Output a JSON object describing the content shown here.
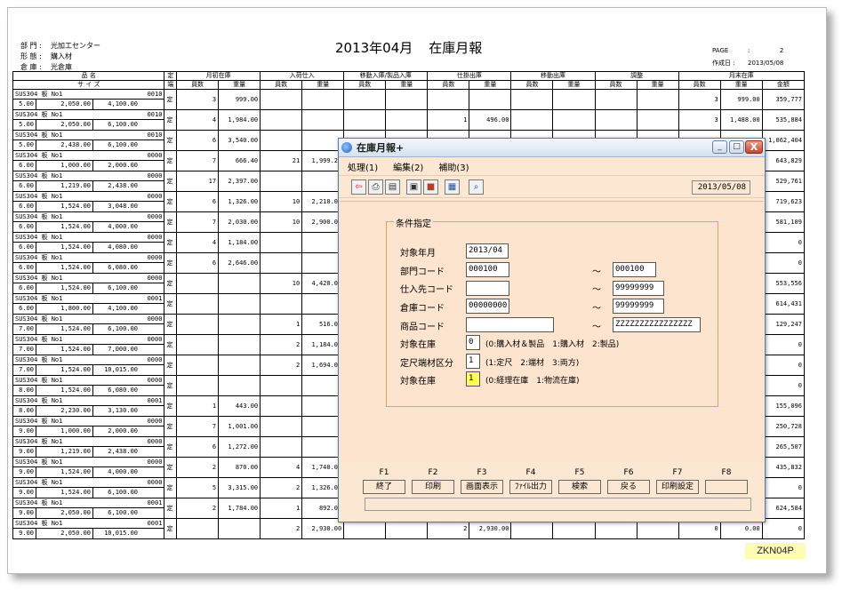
{
  "report": {
    "dept_label": "部 門 :",
    "dept_value": "光加工センター",
    "form_label": "形 態 :",
    "form_value": "購入材",
    "warehouse_label": "倉 庫 :",
    "warehouse_value": "光倉庫",
    "title_period": "2013年04月",
    "title_name": "在庫月報",
    "page_label": "PAGE",
    "page_sep": ":",
    "page_value": "2",
    "created_label": "作成日 :",
    "created_value": "2013/05/08",
    "head": {
      "name": "品 名",
      "size": "サ イ ズ",
      "tei": "定",
      "tan": "端",
      "opening": "月初在庫",
      "purchase": "入荷仕入",
      "transfer_in": "移動入庫/製品入庫",
      "issue": "仕掛出庫",
      "transfer_out": "移動出庫",
      "adjust": "調整",
      "closing": "月末在庫",
      "qty": "員数",
      "weight": "重量",
      "amount": "金額"
    },
    "rows": [
      {
        "name": "SUS304 板 No1",
        "code": "0010",
        "t": "5.00",
        "w": "2,050.00",
        "l": "4,100.00",
        "tei": "定",
        "o_q": "3",
        "o_w": "999.00",
        "p_q": "",
        "p_w": "",
        "i_q": "",
        "i_w": "",
        "c_q": "3",
        "c_w": "999.00",
        "amt": "359,777"
      },
      {
        "name": "SUS304 板 No1",
        "code": "0010",
        "t": "5.00",
        "w": "2,050.00",
        "l": "6,100.00",
        "tei": "定",
        "o_q": "4",
        "o_w": "1,984.00",
        "p_q": "",
        "p_w": "",
        "i_q": "1",
        "i_w": "496.00",
        "c_q": "3",
        "c_w": "1,488.00",
        "amt": "535,884"
      },
      {
        "name": "SUS304 板 No1",
        "code": "0010",
        "t": "5.00",
        "w": "2,438.00",
        "l": "6,100.00",
        "tei": "定",
        "o_q": "6",
        "o_w": "3,540.00",
        "p_q": "",
        "p_w": "",
        "i_q": "",
        "i_w": "",
        "c_q": "",
        "c_w": "",
        "amt": "1,062,404"
      },
      {
        "name": "SUS304 板 No1",
        "code": "0000",
        "t": "6.00",
        "w": "1,000.00",
        "l": "2,000.00",
        "tei": "定",
        "o_q": "7",
        "o_w": "666.40",
        "p_q": "21",
        "p_w": "1,999.20",
        "i_q": "",
        "i_w": "",
        "c_q": "",
        "c_w": "",
        "amt": "643,829"
      },
      {
        "name": "SUS304 板 No1",
        "code": "0000",
        "t": "6.00",
        "w": "1,219.00",
        "l": "2,438.00",
        "tei": "定",
        "o_q": "17",
        "o_w": "2,397.00",
        "p_q": "",
        "p_w": "",
        "i_q": "",
        "i_w": "",
        "c_q": "",
        "c_w": "",
        "amt": "529,761"
      },
      {
        "name": "SUS304 板 No1",
        "code": "0000",
        "t": "6.00",
        "w": "1,524.00",
        "l": "3,048.00",
        "tei": "定",
        "o_q": "6",
        "o_w": "1,326.00",
        "p_q": "10",
        "p_w": "2,210.00",
        "i_q": "",
        "i_w": "",
        "c_q": "",
        "c_w": "",
        "amt": "719,623"
      },
      {
        "name": "SUS304 板 No1",
        "code": "0000",
        "t": "6.00",
        "w": "1,524.00",
        "l": "4,000.00",
        "tei": "定",
        "o_q": "7",
        "o_w": "2,030.00",
        "p_q": "10",
        "p_w": "2,900.00",
        "i_q": "",
        "i_w": "",
        "c_q": "",
        "c_w": "",
        "amt": "581,109"
      },
      {
        "name": "SUS304 板 No1",
        "code": "0000",
        "t": "6.00",
        "w": "1,524.00",
        "l": "4,080.00",
        "tei": "定",
        "o_q": "4",
        "o_w": "1,184.00",
        "p_q": "",
        "p_w": "",
        "i_q": "",
        "i_w": "",
        "c_q": "",
        "c_w": "",
        "amt": "0"
      },
      {
        "name": "SUS304 板 No1",
        "code": "0000",
        "t": "6.00",
        "w": "1,524.00",
        "l": "6,080.00",
        "tei": "定",
        "o_q": "6",
        "o_w": "2,646.00",
        "p_q": "",
        "p_w": "",
        "i_q": "",
        "i_w": "",
        "c_q": "",
        "c_w": "",
        "amt": "0"
      },
      {
        "name": "SUS304 板 No1",
        "code": "0000",
        "t": "6.00",
        "w": "1,524.00",
        "l": "6,100.00",
        "tei": "定",
        "o_q": "",
        "o_w": "",
        "p_q": "10",
        "p_w": "4,420.00",
        "i_q": "",
        "i_w": "",
        "c_q": "",
        "c_w": "",
        "amt": "553,556"
      },
      {
        "name": "SUS304 板 No1",
        "code": "0001",
        "t": "6.00",
        "w": "1,800.00",
        "l": "4,100.00",
        "tei": "定",
        "o_q": "",
        "o_w": "",
        "p_q": "",
        "p_w": "",
        "i_q": "",
        "i_w": "",
        "c_q": "",
        "c_w": "",
        "amt": "614,431"
      },
      {
        "name": "SUS304 板 No1",
        "code": "0000",
        "t": "7.00",
        "w": "1,524.00",
        "l": "6,100.00",
        "tei": "定",
        "o_q": "",
        "o_w": "",
        "p_q": "1",
        "p_w": "516.00",
        "i_q": "",
        "i_w": "",
        "c_q": "",
        "c_w": "",
        "amt": "129,247"
      },
      {
        "name": "SUS304 板 No1",
        "code": "0000",
        "t": "7.00",
        "w": "1,524.00",
        "l": "7,000.00",
        "tei": "定",
        "o_q": "",
        "o_w": "",
        "p_q": "2",
        "p_w": "1,184.00",
        "i_q": "",
        "i_w": "",
        "c_q": "",
        "c_w": "",
        "amt": "0"
      },
      {
        "name": "SUS304 板 No1",
        "code": "0000",
        "t": "7.00",
        "w": "1,524.00",
        "l": "10,015.00",
        "tei": "定",
        "o_q": "",
        "o_w": "",
        "p_q": "2",
        "p_w": "1,694.00",
        "i_q": "",
        "i_w": "",
        "c_q": "",
        "c_w": "",
        "amt": "0"
      },
      {
        "name": "SUS304 板 No1",
        "code": "0000",
        "t": "8.00",
        "w": "1,524.00",
        "l": "6,080.00",
        "tei": "定",
        "o_q": "",
        "o_w": "",
        "p_q": "",
        "p_w": "",
        "i_q": "",
        "i_w": "",
        "c_q": "",
        "c_w": "",
        "amt": "0"
      },
      {
        "name": "SUS304 板 No1",
        "code": "0001",
        "t": "8.00",
        "w": "2,230.00",
        "l": "3,130.00",
        "tei": "定",
        "o_q": "1",
        "o_w": "443.00",
        "p_q": "",
        "p_w": "",
        "i_q": "",
        "i_w": "",
        "c_q": "",
        "c_w": "",
        "amt": "155,096"
      },
      {
        "name": "SUS304 板 No1",
        "code": "0000",
        "t": "9.00",
        "w": "1,000.00",
        "l": "2,000.00",
        "tei": "定",
        "o_q": "7",
        "o_w": "1,001.00",
        "p_q": "",
        "p_w": "",
        "i_q": "",
        "i_w": "",
        "c_q": "",
        "c_w": "",
        "amt": "250,728"
      },
      {
        "name": "SUS304 板 No1",
        "code": "0000",
        "t": "9.00",
        "w": "1,219.00",
        "l": "2,438.00",
        "tei": "定",
        "o_q": "6",
        "o_w": "1,272.00",
        "p_q": "",
        "p_w": "",
        "i_q": "",
        "i_w": "",
        "c_q": "",
        "c_w": "",
        "amt": "265,507"
      },
      {
        "name": "SUS304 板 No1",
        "code": "0000",
        "t": "9.00",
        "w": "1,524.00",
        "l": "4,000.00",
        "tei": "定",
        "o_q": "2",
        "o_w": "870.00",
        "p_q": "4",
        "p_w": "1,740.00",
        "i_q": "",
        "i_w": "",
        "c_q": "",
        "c_w": "",
        "amt": "435,832"
      },
      {
        "name": "SUS304 板 No1",
        "code": "0000",
        "t": "9.00",
        "w": "1,524.00",
        "l": "6,100.00",
        "tei": "定",
        "o_q": "5",
        "o_w": "3,315.00",
        "p_q": "2",
        "p_w": "1,326.00",
        "i_q": "",
        "i_w": "",
        "c_q": "",
        "c_w": "",
        "amt": "0"
      },
      {
        "name": "SUS304 板 No1",
        "code": "0001",
        "t": "9.00",
        "w": "2,050.00",
        "l": "6,100.00",
        "tei": "定",
        "o_q": "2",
        "o_w": "1,784.00",
        "p_q": "1",
        "p_w": "892.00",
        "i_q": "",
        "i_w": "",
        "c_q": "",
        "c_w": "",
        "amt": "624,584"
      },
      {
        "name": "SUS304 板 No1",
        "code": "0001",
        "t": "9.00",
        "w": "2,050.00",
        "l": "10,015.00",
        "tei": "定",
        "o_q": "",
        "o_w": "",
        "p_q": "2",
        "p_w": "2,930.00",
        "i_q": "2",
        "i_w": "2,930.00",
        "c_q": "0",
        "c_w": "0.00",
        "amt": "0"
      }
    ]
  },
  "stamp": "ZKN04P",
  "window": {
    "title": "在庫月報+",
    "min": "_",
    "max": "□",
    "close": "X",
    "menu": [
      "処理(1)",
      "編集(2)",
      "補助(3)"
    ],
    "date": "2013/05/08",
    "toolbar_icons": [
      {
        "name": "exit-icon",
        "glyph": "⇦",
        "color": "#c0392b"
      },
      {
        "name": "print-icon",
        "glyph": "⎙",
        "color": "#333"
      },
      {
        "name": "preview-icon",
        "glyph": "▤",
        "color": "#333"
      },
      {
        "name": "save-icon",
        "glyph": "▣",
        "color": "#333"
      },
      {
        "name": "export-icon",
        "glyph": "■",
        "color": "#c0392b"
      },
      {
        "name": "settings-icon",
        "glyph": "▦",
        "color": "#1f4fa8"
      },
      {
        "name": "search-icon",
        "glyph": "⌕",
        "color": "#1f4fa8"
      }
    ],
    "group_label": "条件指定",
    "fields": {
      "target_month_label": "対象年月",
      "target_month_value": "2013/04",
      "dept_code_label": "部門コード",
      "dept_from": "000100",
      "dept_to": "000100",
      "supplier_label": "仕入先コード",
      "supplier_from": "",
      "supplier_to": "99999999",
      "warehouse_label": "倉庫コード",
      "warehouse_from": "00000000",
      "warehouse_to": "99999999",
      "product_label": "商品コード",
      "product_from": "",
      "product_to": "ZZZZZZZZZZZZZZZZ",
      "stock_type_label": "対象在庫",
      "stock_type_value": "0",
      "stock_type_note": "(0:購入材＆製品　1:購入材　2:製品)",
      "cut_label": "定尺端材区分",
      "cut_value": "1",
      "cut_note": "(1:定尺　2:端材　3:両方)",
      "stock_kind_label": "対象在庫",
      "stock_kind_value": "1",
      "stock_kind_note": "(0:経理在庫　1:物流在庫)",
      "tilde": "～"
    },
    "fkeys": [
      {
        "key": "F1",
        "label": "終了"
      },
      {
        "key": "F2",
        "label": "印刷"
      },
      {
        "key": "F3",
        "label": "画面表示"
      },
      {
        "key": "F4",
        "label": "ﾌｧｲﾙ出力"
      },
      {
        "key": "F5",
        "label": "検索"
      },
      {
        "key": "F6",
        "label": "戻る"
      },
      {
        "key": "F7",
        "label": "印刷設定"
      },
      {
        "key": "F8",
        "label": ""
      }
    ]
  }
}
